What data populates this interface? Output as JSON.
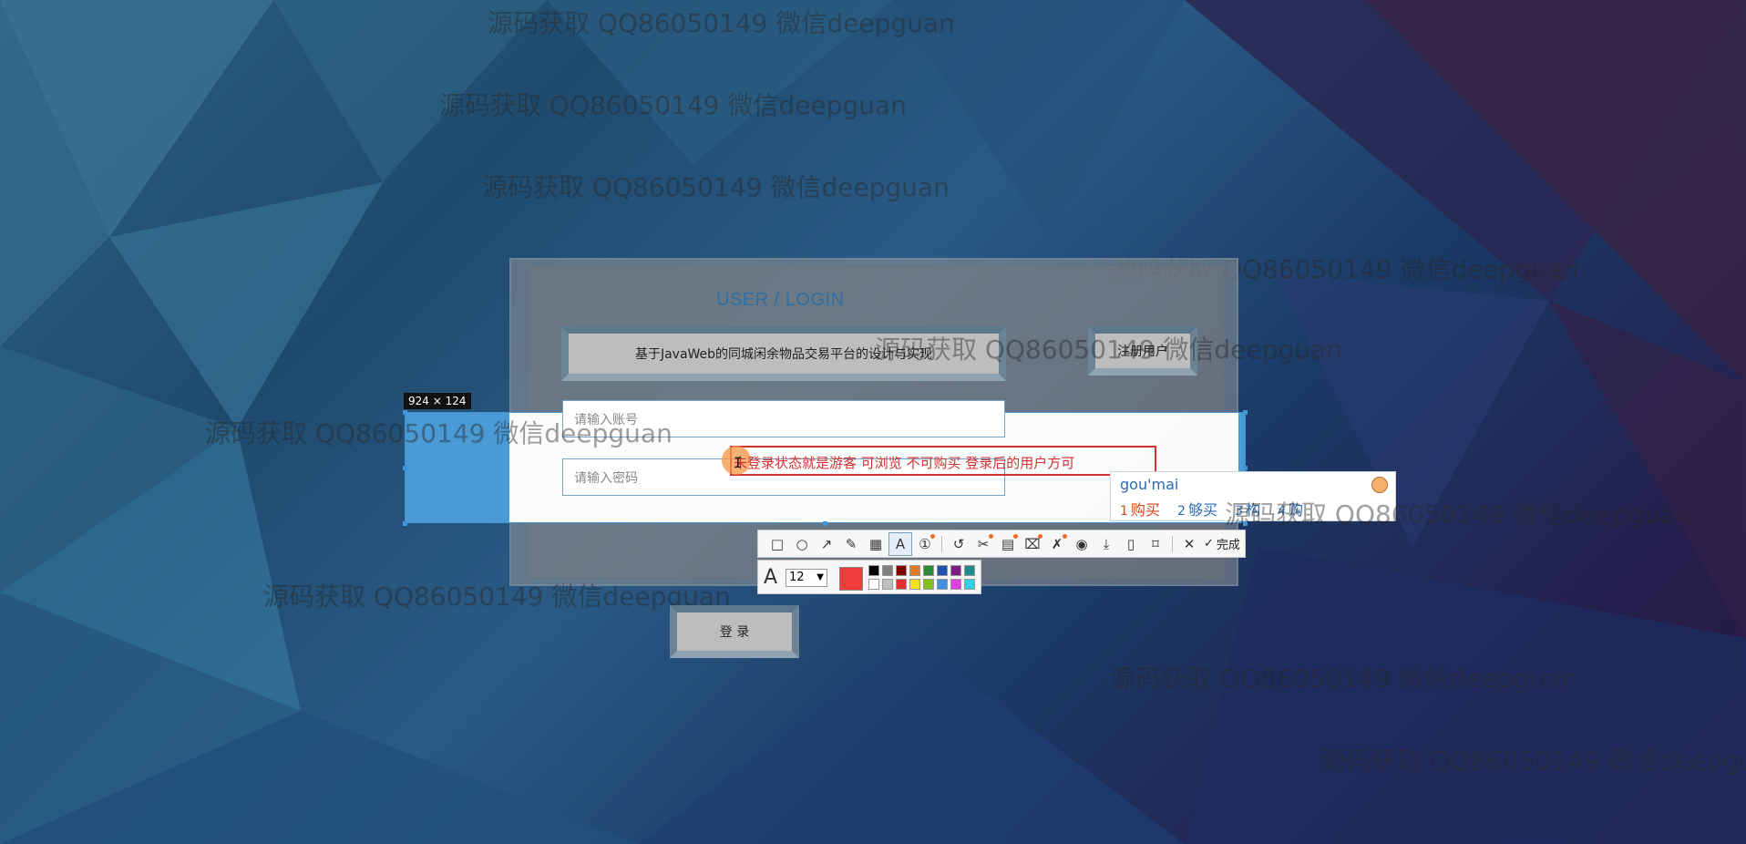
{
  "watermark_text": "源码获取 QQ86050149 微信deepguan",
  "login": {
    "title": "USER / LOGIN",
    "system_name": "基于JavaWeb的同城闲余物品交易平台的设计与实现",
    "register_button": "注册用户",
    "account_placeholder": "请输入账号",
    "password_placeholder": "请输入密码",
    "login_button": "登 录"
  },
  "capture": {
    "size_label": "924 × 124",
    "annotation_text": "未登录状态就是游客  可浏览 不可购买  登录后的用户方可"
  },
  "ime": {
    "input": "gou'mai",
    "candidates": [
      {
        "num": "1",
        "text": "购买",
        "color": "#d8431e"
      },
      {
        "num": "2",
        "text": "够买",
        "color": "#2a6bb0"
      },
      {
        "num": "3",
        "text": "构",
        "color": "#2a6bb0"
      },
      {
        "num": "4",
        "text": "购",
        "color": "#2a6bb0"
      }
    ]
  },
  "toolbar": {
    "tools": [
      {
        "name": "rectangle-tool-button",
        "icon": "□"
      },
      {
        "name": "ellipse-tool-button",
        "icon": "○"
      },
      {
        "name": "arrow-tool-button",
        "icon": "↗"
      },
      {
        "name": "pencil-tool-button",
        "icon": "✎"
      },
      {
        "name": "mosaic-tool-button",
        "icon": "▦"
      },
      {
        "name": "text-tool-button",
        "icon": "A"
      },
      {
        "name": "number-tool-button",
        "icon": "①"
      },
      {
        "name": "undo-button",
        "icon": "↺"
      },
      {
        "name": "cut-tool-button",
        "icon": "✂"
      },
      {
        "name": "ocr-button",
        "icon": "▤"
      },
      {
        "name": "scan-button",
        "icon": "⌧"
      },
      {
        "name": "pin-button",
        "icon": "✗"
      },
      {
        "name": "record-button",
        "icon": "◉"
      },
      {
        "name": "save-button",
        "icon": "⤓"
      },
      {
        "name": "phone-button",
        "icon": "▯"
      },
      {
        "name": "bookmark-button",
        "icon": "⌑"
      },
      {
        "name": "close-button",
        "icon": "✕"
      }
    ],
    "done_label": "完成",
    "font_size": "12",
    "current_color": "#f03b3b",
    "palette": [
      "#000000",
      "#808080",
      "#800000",
      "#e07b2b",
      "#2a8a3a",
      "#2050b0",
      "#7a1f80",
      "#1f8a8a",
      "#ffffff",
      "#c0c0c0",
      "#e03030",
      "#f0e020",
      "#80c020",
      "#4090e0",
      "#e040e0",
      "#30d0e0"
    ]
  }
}
